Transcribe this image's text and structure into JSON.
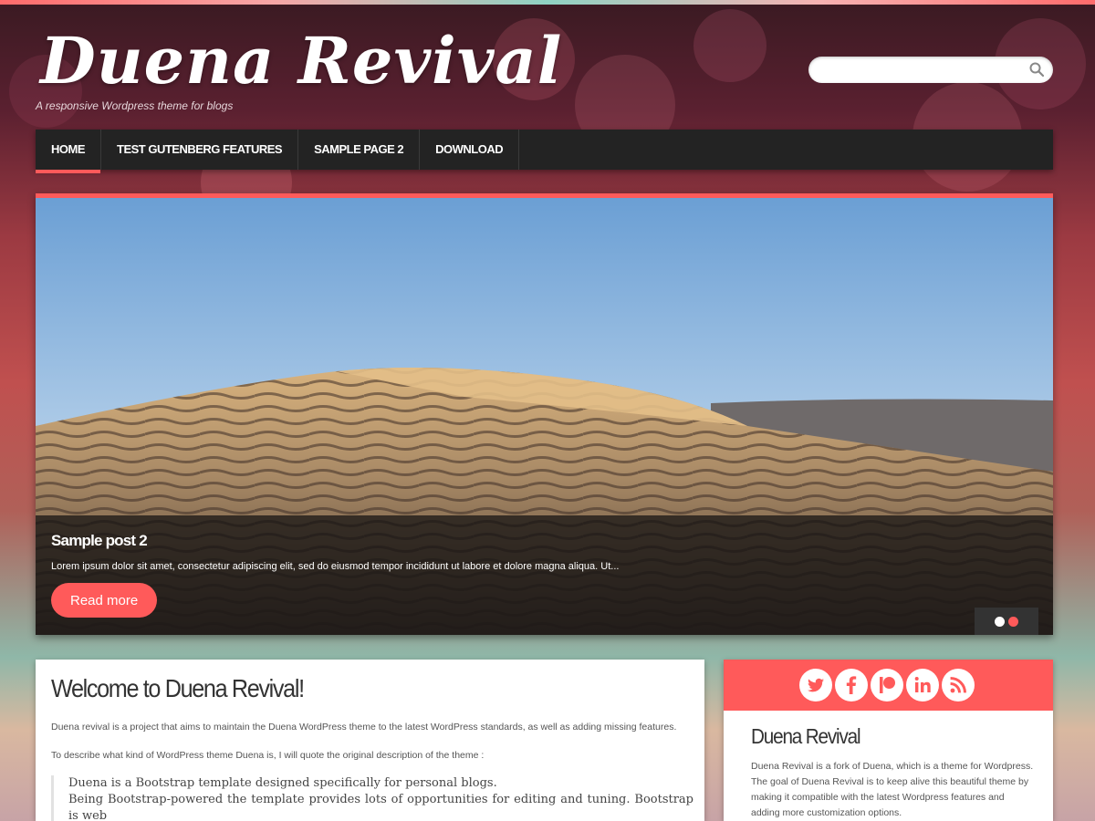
{
  "site": {
    "title": "Duena Revival",
    "tagline": "A responsive Wordpress theme for blogs",
    "accent_color": "#ff5a5a"
  },
  "search": {
    "placeholder": "",
    "value": "",
    "icon": "search-icon"
  },
  "nav": {
    "items": [
      {
        "label": "HOME",
        "active": true
      },
      {
        "label": "TEST GUTENBERG FEATURES",
        "active": false
      },
      {
        "label": "SAMPLE PAGE 2",
        "active": false
      },
      {
        "label": "DOWNLOAD",
        "active": false
      }
    ]
  },
  "slider": {
    "title": "Sample post 2",
    "excerpt": "Lorem ipsum dolor sit amet, consectetur adipiscing elit, sed do eiusmod tempor incididunt ut labore et dolore magna aliqua. Ut...",
    "button_label": "Read more",
    "slide_count": 2,
    "active_slide": 2
  },
  "main": {
    "title": "Welcome to Duena Revival!",
    "paragraph1": "Duena revival is a project that aims to maintain the Duena WordPress theme to the latest WordPress standards, as well as adding missing features.",
    "paragraph2": "To describe what kind of WordPress theme Duena is, I will quote the original description of the theme :",
    "quote_line1": "Duena is a Bootstrap template designed specifically for personal blogs.",
    "quote_line2": "Being Bootstrap-powered the template provides lots of opportunities for editing and tuning. Bootstrap is web"
  },
  "sidebar": {
    "social": [
      "twitter-icon",
      "facebook-icon",
      "patreon-icon",
      "linkedin-icon",
      "rss-icon"
    ],
    "title": "Duena Revival",
    "text": "Duena Revival is a fork of Duena, which is a theme for Wordpress. The goal of Duena Revival is to keep alive this beautiful theme by making it compatible with the latest Wordpress features and adding more customization options."
  }
}
